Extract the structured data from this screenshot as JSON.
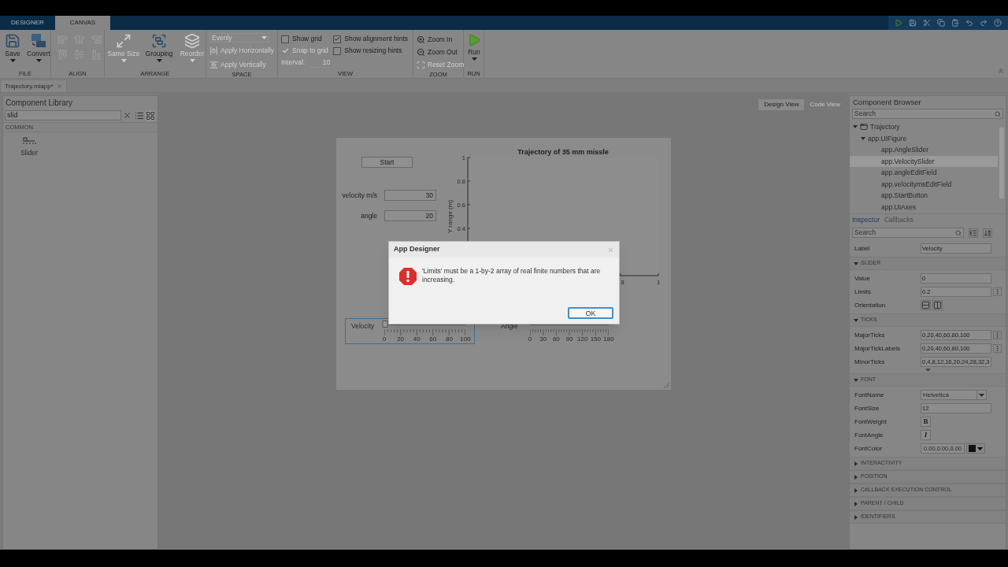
{
  "tabs": [
    {
      "label": "DESIGNER",
      "selected": false
    },
    {
      "label": "CANVAS",
      "selected": true
    }
  ],
  "toolstrip": {
    "file": {
      "label": "FILE",
      "save": {
        "label": "Save",
        "disabled": false
      },
      "convert": {
        "label": "Convert",
        "disabled": false
      }
    },
    "align": {
      "label": "ALIGN",
      "disabled": true
    },
    "arrange": {
      "label": "ARRANGE",
      "same_size": {
        "label": "Same Size",
        "disabled": true
      },
      "grouping": {
        "label": "Grouping",
        "disabled": false
      },
      "reorder": {
        "label": "Reorder",
        "disabled": true
      }
    },
    "space": {
      "label": "SPACE",
      "distribution": {
        "value": "Evenly",
        "disabled": true
      },
      "apply_horizontally": {
        "label": "Apply Horizontally",
        "disabled": true
      },
      "apply_vertically": {
        "label": "Apply Vertically",
        "disabled": true
      }
    },
    "view": {
      "label": "VIEW",
      "show_grid": {
        "label": "Show grid",
        "checked": false,
        "disabled": false
      },
      "snap_to_grid": {
        "label": "Snap to grid",
        "checked": true,
        "disabled": true
      },
      "interval": {
        "label": "Interval:",
        "value": "10",
        "disabled": true
      },
      "show_alignment_hints": {
        "label": "Show alignment hints",
        "checked": true,
        "disabled": false
      },
      "show_resizing_hints": {
        "label": "Show resizing hints",
        "checked": false,
        "disabled": false
      }
    },
    "zoom": {
      "label": "ZOOM",
      "zoom_in": {
        "label": "Zoom In",
        "disabled": false
      },
      "zoom_out": {
        "label": "Zoom Out",
        "disabled": false
      },
      "reset_zoom": {
        "label": "Reset Zoom",
        "disabled": true
      }
    },
    "run": {
      "label": "RUN",
      "run": {
        "label": "Run",
        "disabled": false
      }
    }
  },
  "document_tabs": [
    {
      "label": "Trajectory.mlapp*",
      "selected": true
    }
  ],
  "component_library": {
    "title": "Component Library",
    "search": {
      "value": "slid"
    },
    "section": "COMMON",
    "items": [
      {
        "label": "Slider"
      }
    ]
  },
  "view_switch": [
    {
      "label": "Design View",
      "selected": true
    },
    {
      "label": "Code View",
      "selected": false
    }
  ],
  "canvas": {
    "start_button": "Start",
    "fields": [
      {
        "label": "velocity m/s",
        "value": "30"
      },
      {
        "label": "angle",
        "value": "20"
      }
    ],
    "axes": {
      "title": "Trajectory of 35 mm missle",
      "ylabel": "Y range (m)",
      "y_tick_labels": [
        "1",
        "0.8",
        "0.6",
        "0.4"
      ],
      "x_tick_labels": [
        "8",
        "1"
      ]
    },
    "sliders": [
      {
        "label": "Velocity",
        "selected": true,
        "level": 0,
        "ticks": [
          "0",
          "20",
          "40",
          "60",
          "80",
          "100"
        ]
      },
      {
        "label": "Angle",
        "selected": false,
        "ticks": [
          "0",
          "30",
          "60",
          "90",
          "120",
          "150",
          "180"
        ]
      }
    ]
  },
  "dialog": {
    "title": "App Designer",
    "message": "'Limits' must be a 1-by-2 array of real finite numbers that are increasing.",
    "button": "OK"
  },
  "component_browser": {
    "title": "Component Browser",
    "search_placeholder": "Search",
    "tree": [
      {
        "label": "Trajectory",
        "expanded": true,
        "selected": false,
        "children": [
          {
            "label": "app.UIFigure",
            "expanded": true,
            "selected": false,
            "children": [
              {
                "label": "app.AngleSlider",
                "selected": false
              },
              {
                "label": "app.VelocitySlider",
                "selected": true
              },
              {
                "label": "app.angleEditField",
                "selected": false
              },
              {
                "label": "app.velocitymsEditField",
                "selected": false
              },
              {
                "label": "app.StartButton",
                "selected": false
              },
              {
                "label": "app.UIAxes",
                "selected": false
              }
            ]
          }
        ]
      }
    ]
  },
  "inspector": {
    "tabs": [
      {
        "label": "Inspector",
        "selected": true
      },
      {
        "label": "Callbacks",
        "selected": false
      }
    ],
    "search_placeholder": "Search",
    "label_property": {
      "name": "Label",
      "value": "Velocity"
    },
    "sections": [
      {
        "title": "SLIDER",
        "expanded": true,
        "properties": [
          {
            "kind": "text",
            "name": "Value",
            "value": "0",
            "more": false
          },
          {
            "kind": "text",
            "name": "Limits",
            "value": "0.2",
            "more": true
          },
          {
            "kind": "orientation",
            "name": "Orientation"
          }
        ]
      },
      {
        "title": "TICKS",
        "expanded": true,
        "more_rows": true,
        "properties": [
          {
            "kind": "text",
            "name": "MajorTicks",
            "value": "0,20,40,60,80,100",
            "more": true
          },
          {
            "kind": "text",
            "name": "MajorTickLabels",
            "value": "0,20,40,60,80,100",
            "more": true
          },
          {
            "kind": "text",
            "name": "MinorTicks",
            "value": "0,4,8,12,16,20,24,28,32,3",
            "more": false
          }
        ]
      },
      {
        "title": "FONT",
        "expanded": true,
        "properties": [
          {
            "kind": "dropdown",
            "name": "FontName",
            "value": "Helvetica"
          },
          {
            "kind": "text",
            "name": "FontSize",
            "value": "12",
            "more": false
          },
          {
            "kind": "bold",
            "name": "FontWeight",
            "value": "B"
          },
          {
            "kind": "italic",
            "name": "FontAngle",
            "value": "I"
          },
          {
            "kind": "color",
            "name": "FontColor",
            "value": "0.00,0.00,0.00"
          }
        ]
      },
      {
        "title": "INTERACTIVITY",
        "expanded": false
      },
      {
        "title": "POSITION",
        "expanded": false
      },
      {
        "title": "CALLBACK EXECUTION CONTROL",
        "expanded": false
      },
      {
        "title": "PARENT / CHILD",
        "expanded": false
      },
      {
        "title": "IDENTIFIERS",
        "expanded": false
      }
    ]
  }
}
